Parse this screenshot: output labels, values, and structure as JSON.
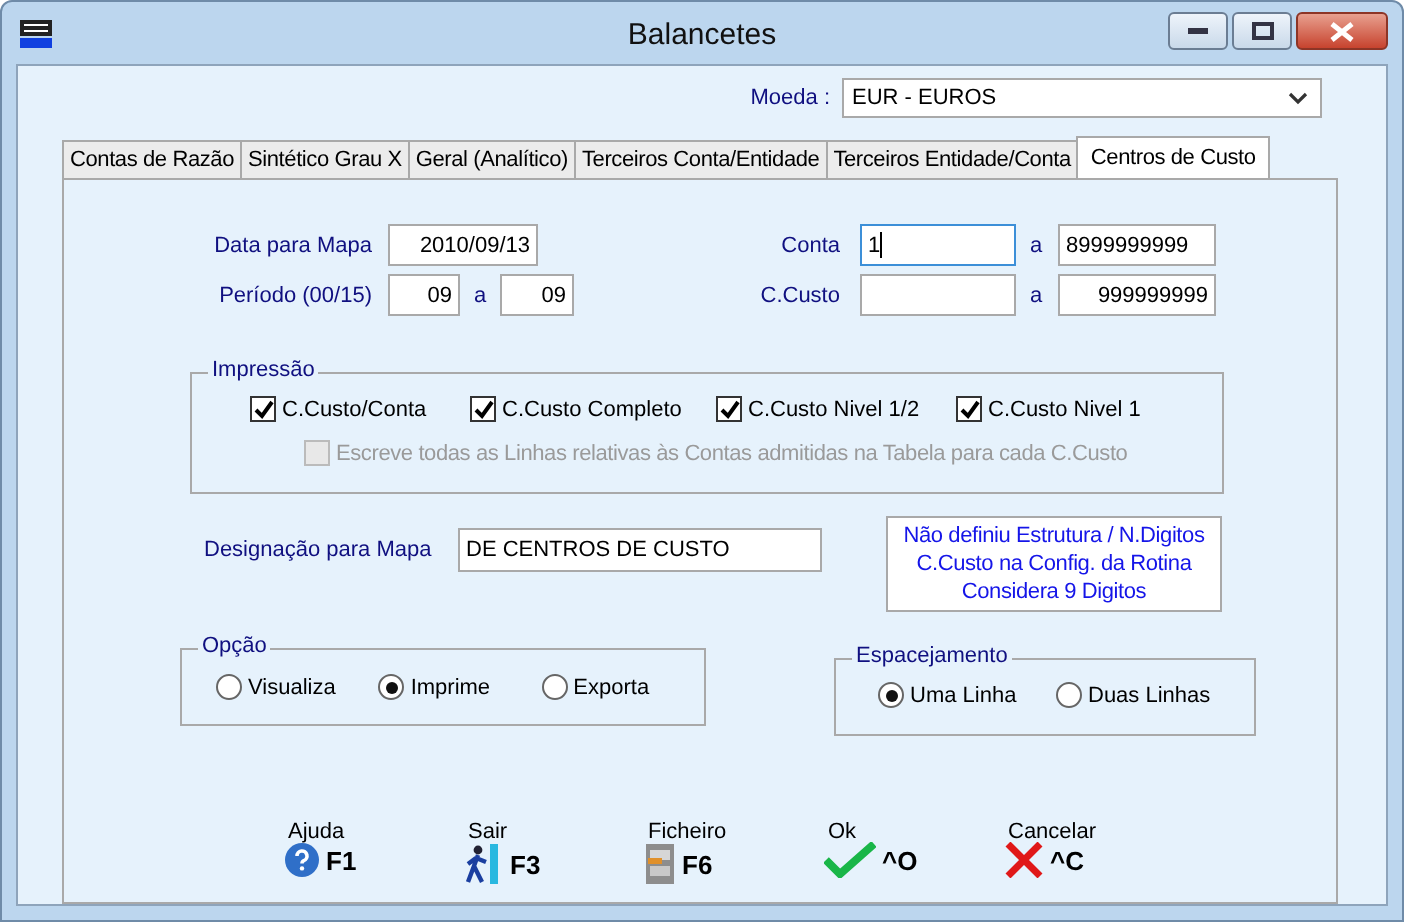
{
  "window": {
    "title": "Balancetes"
  },
  "currency": {
    "label": "Moeda :",
    "value": "EUR - EUROS"
  },
  "tabs": [
    {
      "label": "Contas de Razão",
      "selected": false
    },
    {
      "label": "Sintético Grau X",
      "selected": false
    },
    {
      "label": "Geral (Analítico)",
      "selected": false
    },
    {
      "label": "Terceiros Conta/Entidade",
      "selected": false
    },
    {
      "label": "Terceiros Entidade/Conta",
      "selected": false
    },
    {
      "label": "Centros de Custo",
      "selected": true
    }
  ],
  "date": {
    "label": "Data para Mapa",
    "value": "2010/09/13"
  },
  "period": {
    "label": "Período (00/15)",
    "from": "09",
    "separator": "a",
    "to": "09"
  },
  "account": {
    "label": "Conta",
    "from": "1",
    "separator": "a",
    "to": "8999999999",
    "focused": true
  },
  "cost_center": {
    "label": "C.Custo",
    "separator": "a",
    "to": "999999999"
  },
  "printing": {
    "title": "Impressão",
    "options": [
      {
        "label": "C.Custo/Conta",
        "checked": true,
        "disabled": false
      },
      {
        "label": "C.Custo Completo",
        "checked": true,
        "disabled": false
      },
      {
        "label": "C.Custo Nivel 1/2",
        "checked": true,
        "disabled": false
      },
      {
        "label": "C.Custo Nivel 1",
        "checked": true,
        "disabled": false
      },
      {
        "label": "Escreve todas as Linhas relativas às Contas admitidas na Tabela para cada C.Custo",
        "checked": false,
        "disabled": true
      }
    ]
  },
  "designation": {
    "label": "Designação para Mapa",
    "value": "DE CENTROS DE CUSTO"
  },
  "notice": [
    "Não definiu Estrutura / N.Digitos",
    "C.Custo na Config. da Rotina",
    "Considera 9 Digitos"
  ],
  "option": {
    "title": "Opção",
    "choices": [
      {
        "label": "Visualiza",
        "selected": false
      },
      {
        "label": "Imprime",
        "selected": true
      },
      {
        "label": "Exporta",
        "selected": false
      }
    ]
  },
  "spacing": {
    "title": "Espacejamento",
    "choices": [
      {
        "label": "Uma Linha",
        "selected": true
      },
      {
        "label": "Duas Linhas",
        "selected": false
      }
    ]
  },
  "buttons": [
    {
      "label": "Ajuda",
      "kind": "help",
      "key": "F1"
    },
    {
      "label": "Sair",
      "kind": "exit",
      "key": "F3"
    },
    {
      "label": "Ficheiro",
      "kind": "file",
      "key": "F6"
    },
    {
      "label": "Ok",
      "kind": "ok",
      "key": "^O"
    },
    {
      "label": "Cancelar",
      "kind": "cancel",
      "key": "^C"
    }
  ]
}
